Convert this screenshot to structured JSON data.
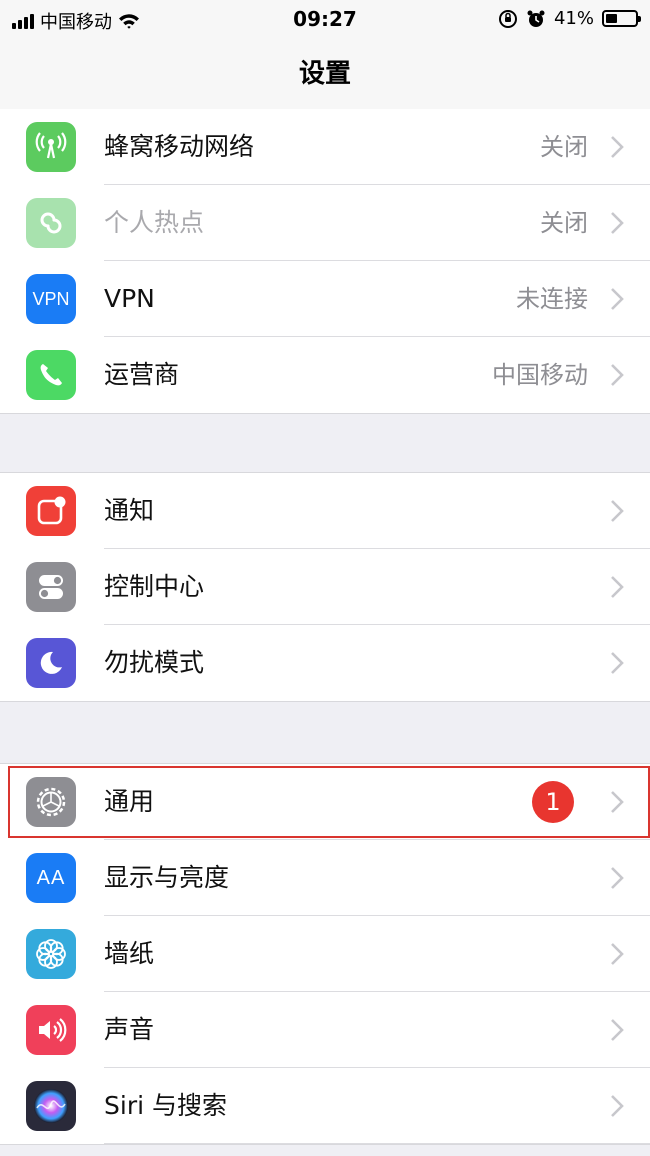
{
  "status_bar": {
    "carrier": "中国移动",
    "time": "09:27",
    "battery_percent": "41%",
    "battery_level": 0.41
  },
  "nav": {
    "title": "设置"
  },
  "groups": [
    {
      "rows": [
        {
          "label": "蜂窝移动网络",
          "value": "关闭",
          "icon": "cellular-icon",
          "icon_color": "#5ccb5f"
        },
        {
          "label": "个人热点",
          "value": "关闭",
          "icon": "hotspot-icon",
          "icon_color": "#a8e2ae",
          "disabled": true
        },
        {
          "label": "VPN",
          "value": "未连接",
          "icon": "vpn-icon",
          "icon_color": "#1a7cf5",
          "icon_text": "VPN"
        },
        {
          "label": "运营商",
          "value": "中国移动",
          "icon": "phone-icon",
          "icon_color": "#4cd964"
        }
      ]
    },
    {
      "rows": [
        {
          "label": "通知",
          "value": "",
          "icon": "notifications-icon",
          "icon_color": "#f04038"
        },
        {
          "label": "控制中心",
          "value": "",
          "icon": "control-center-icon",
          "icon_color": "#8e8e93"
        },
        {
          "label": "勿扰模式",
          "value": "",
          "icon": "moon-icon",
          "icon_color": "#5856d6"
        }
      ]
    },
    {
      "rows": [
        {
          "label": "通用",
          "value": "",
          "badge": "1",
          "icon": "gear-icon",
          "icon_color": "#8e8e93"
        },
        {
          "label": "显示与亮度",
          "value": "",
          "icon": "display-icon",
          "icon_color": "#1a7cf5",
          "icon_text": "AA"
        },
        {
          "label": "墙纸",
          "value": "",
          "icon": "wallpaper-icon",
          "icon_color": "#34aadc"
        },
        {
          "label": "声音",
          "value": "",
          "icon": "sound-icon",
          "icon_color": "#f0405a"
        },
        {
          "label": "Siri 与搜索",
          "value": "",
          "icon": "siri-icon",
          "icon_color": "#2a2a3a"
        }
      ]
    }
  ],
  "colors": {
    "highlight_box": "#d9352f",
    "badge": "#e8352f",
    "background": "#efeff4"
  }
}
